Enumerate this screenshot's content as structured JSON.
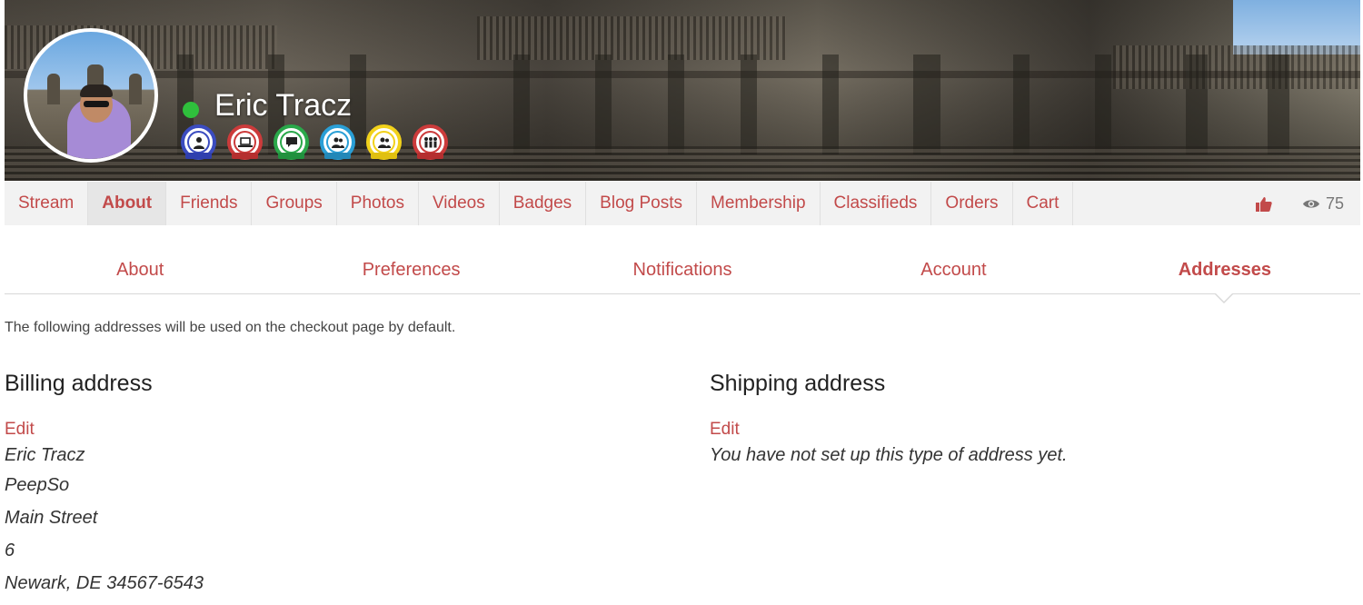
{
  "profile": {
    "name": "Eric Tracz",
    "online": true,
    "badges": [
      {
        "icon": "person-icon",
        "color": "#3b4cc0",
        "ribbon": "#2f3fae"
      },
      {
        "icon": "laptop-icon",
        "color": "#cc3b3b",
        "ribbon": "#b52f2f"
      },
      {
        "icon": "chat-icon",
        "color": "#2aa84a",
        "ribbon": "#21913e"
      },
      {
        "icon": "group-icon",
        "color": "#2a9fd6",
        "ribbon": "#2388b8"
      },
      {
        "icon": "group-icon",
        "color": "#f2d21b",
        "ribbon": "#e0c010"
      },
      {
        "icon": "family-icon",
        "color": "#cc3b3b",
        "ribbon": "#b52f2f"
      }
    ]
  },
  "nav": {
    "items": [
      "Stream",
      "About",
      "Friends",
      "Groups",
      "Photos",
      "Videos",
      "Badges",
      "Blog Posts",
      "Membership",
      "Classifieds",
      "Orders",
      "Cart"
    ],
    "active": "About",
    "views": "75"
  },
  "subtabs": {
    "items": [
      "About",
      "Preferences",
      "Notifications",
      "Account",
      "Addresses"
    ],
    "active": "Addresses"
  },
  "content": {
    "intro": "The following addresses will be used on the checkout page by default.",
    "billing": {
      "title": "Billing address",
      "edit": "Edit",
      "lines": [
        "Eric Tracz",
        "PeepSo",
        "Main Street",
        "6",
        "Newark, DE 34567-6543"
      ]
    },
    "shipping": {
      "title": "Shipping address",
      "edit": "Edit",
      "empty": "You have not set up this type of address yet."
    }
  },
  "colors": {
    "accent": "#c24a4a",
    "online": "#2fbf3c",
    "navbar_bg": "#f2f2f2"
  }
}
